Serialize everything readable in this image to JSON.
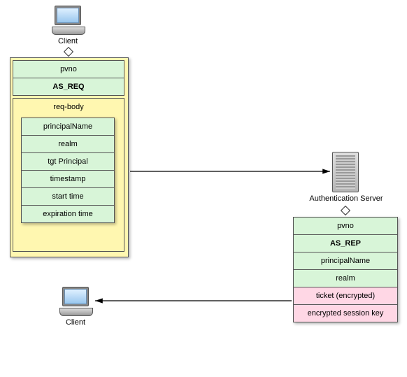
{
  "client_top": {
    "label": "Client"
  },
  "client_bottom": {
    "label": "Client"
  },
  "auth_server": {
    "label": "Authentication Server"
  },
  "request": {
    "pvno": "pvno",
    "msg_type": "AS_REQ",
    "body_label": "req-body",
    "body_fields": [
      "principalName",
      "realm",
      "tgt Principal",
      "timestamp",
      "start time",
      "expiration time"
    ]
  },
  "response": {
    "fields": [
      {
        "text": "pvno",
        "style": "green",
        "bold": false
      },
      {
        "text": "AS_REP",
        "style": "green",
        "bold": true
      },
      {
        "text": "principalName",
        "style": "green",
        "bold": false
      },
      {
        "text": "realm",
        "style": "green",
        "bold": false
      },
      {
        "text": "ticket (encrypted)",
        "style": "pink",
        "bold": false
      },
      {
        "text": "encrypted session key",
        "style": "pink",
        "bold": false
      }
    ]
  }
}
